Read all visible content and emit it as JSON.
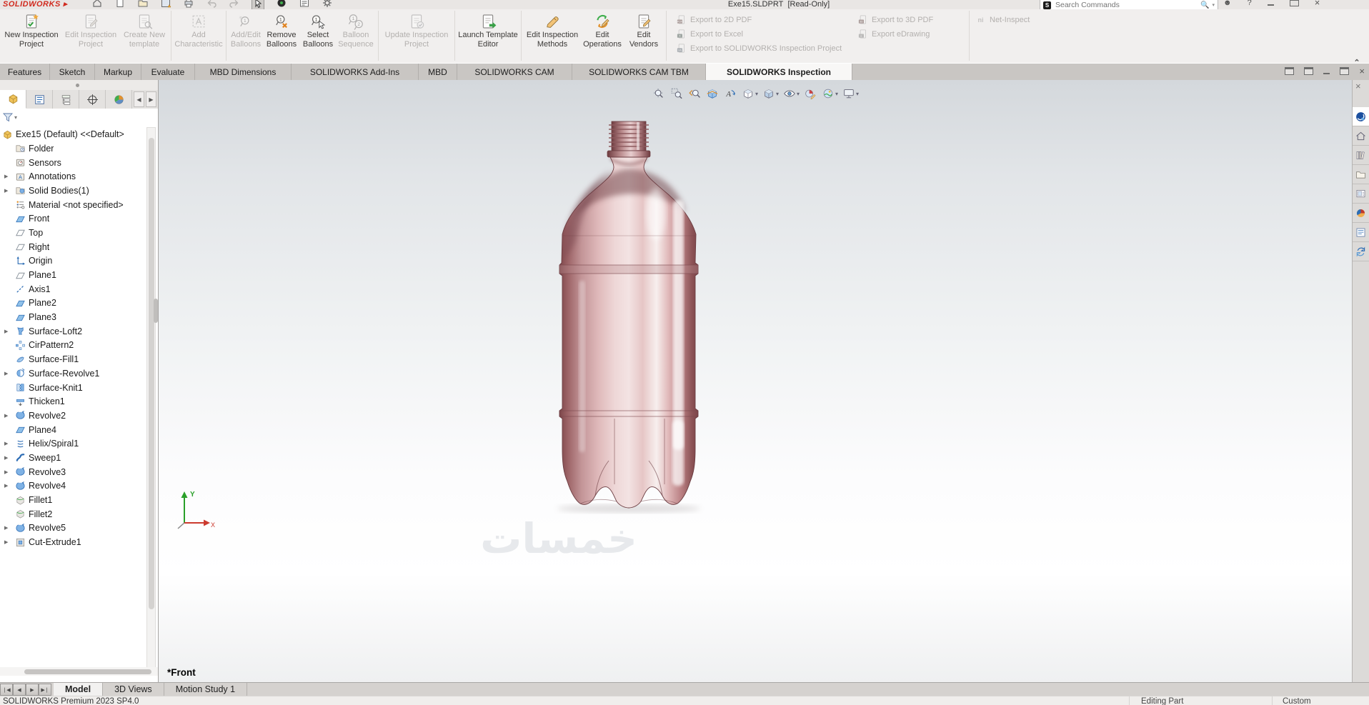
{
  "window": {
    "app": "SOLIDWORKS",
    "title": "Exe15.SLDPRT",
    "mode": "[Read-Only]",
    "search_placeholder": "Search Commands"
  },
  "quick_access": [
    {
      "icon": "home-icon"
    },
    {
      "icon": "new-doc-icon"
    },
    {
      "icon": "open-icon"
    },
    {
      "icon": "save-icon"
    },
    {
      "icon": "print-icon"
    },
    {
      "icon": "undo-icon",
      "enabled": false
    },
    {
      "icon": "redo-icon",
      "enabled": false
    },
    {
      "icon": "select-cursor-icon",
      "active": true
    },
    {
      "icon": "rebuild-icon"
    },
    {
      "icon": "display-settings-icon"
    },
    {
      "icon": "options-gear-icon"
    }
  ],
  "ribbon": {
    "buttons": [
      {
        "label": "New Inspection Project",
        "icon": "new-inspection-project",
        "enabled": true
      },
      {
        "label": "Edit Inspection Project",
        "icon": "edit-inspection-project",
        "enabled": false
      },
      {
        "label": "Create New template",
        "icon": "create-new-template",
        "enabled": false,
        "sep": true
      },
      {
        "label": "Add Characteristic",
        "icon": "add-characteristic",
        "enabled": false,
        "sep": true
      },
      {
        "label": "Add/Edit Balloons",
        "icon": "add-edit-balloons",
        "enabled": false
      },
      {
        "label": "Remove Balloons",
        "icon": "remove-balloons",
        "enabled": true
      },
      {
        "label": "Select Balloons",
        "icon": "select-balloons",
        "enabled": true
      },
      {
        "label": "Balloon Sequence",
        "icon": "balloon-sequence",
        "enabled": false,
        "sep": true
      },
      {
        "label": "Update Inspection Project",
        "icon": "update-inspection-project",
        "enabled": false,
        "sep": true
      },
      {
        "label": "Launch Template Editor",
        "icon": "launch-template-editor",
        "enabled": true,
        "sep": true
      },
      {
        "label": "Edit Inspection Methods",
        "icon": "edit-inspection-methods",
        "enabled": true
      },
      {
        "label": "Edit Operations",
        "icon": "edit-operations",
        "enabled": true
      },
      {
        "label": "Edit Vendors",
        "icon": "edit-vendors",
        "enabled": true,
        "sep": true
      }
    ],
    "export_left": [
      {
        "label": "Export to 2D PDF",
        "icon": "export-2d-pdf",
        "enabled": false
      },
      {
        "label": "Export to Excel",
        "icon": "export-excel",
        "enabled": false
      },
      {
        "label": "Export to SOLIDWORKS Inspection Project",
        "icon": "export-sw-inspection",
        "enabled": false
      }
    ],
    "export_right": [
      {
        "label": "Export to 3D PDF",
        "icon": "export-3d-pdf",
        "enabled": false
      },
      {
        "label": "Export eDrawing",
        "icon": "export-edrawing",
        "enabled": false
      }
    ],
    "net_inspect": {
      "label": "Net-Inspect",
      "icon": "net-inspect",
      "enabled": false
    }
  },
  "tabs": [
    {
      "label": "Features"
    },
    {
      "label": "Sketch"
    },
    {
      "label": "Markup"
    },
    {
      "label": "Evaluate"
    },
    {
      "label": "MBD Dimensions"
    },
    {
      "label": "SOLIDWORKS Add-Ins"
    },
    {
      "label": "MBD"
    },
    {
      "label": "SOLIDWORKS CAM"
    },
    {
      "label": "SOLIDWORKS CAM TBM"
    },
    {
      "label": "SOLIDWORKS Inspection",
      "active": true
    }
  ],
  "panel": {
    "tabs": [
      {
        "icon": "featuremanager-icon",
        "active": true
      },
      {
        "icon": "propertymanager-icon"
      },
      {
        "icon": "configurationmanager-icon"
      },
      {
        "icon": "dimxpertmanager-icon"
      },
      {
        "icon": "displaymanager-icon"
      }
    ],
    "tree": {
      "root": {
        "label": "Exe15 (Default) <<Default>",
        "icon": "part"
      },
      "items": [
        {
          "label": "Folder",
          "icon": "folder-history"
        },
        {
          "label": "Sensors",
          "icon": "sensors"
        },
        {
          "label": "Annotations",
          "icon": "annotations",
          "expandable": true
        },
        {
          "label": "Solid Bodies(1)",
          "icon": "solid-bodies",
          "expandable": true
        },
        {
          "label": "Material <not specified>",
          "icon": "material"
        },
        {
          "label": "Front",
          "icon": "plane-shaded"
        },
        {
          "label": "Top",
          "icon": "plane"
        },
        {
          "label": "Right",
          "icon": "plane"
        },
        {
          "label": "Origin",
          "icon": "origin"
        },
        {
          "label": "Plane1",
          "icon": "plane"
        },
        {
          "label": "Axis1",
          "icon": "axis"
        },
        {
          "label": "Plane2",
          "icon": "plane-shaded"
        },
        {
          "label": "Plane3",
          "icon": "plane-shaded"
        },
        {
          "label": "Surface-Loft2",
          "icon": "surface-loft",
          "expandable": true
        },
        {
          "label": "CirPattern2",
          "icon": "cirpattern"
        },
        {
          "label": "Surface-Fill1",
          "icon": "surface-fill"
        },
        {
          "label": "Surface-Revolve1",
          "icon": "surface-revolve",
          "expandable": true
        },
        {
          "label": "Surface-Knit1",
          "icon": "surface-knit"
        },
        {
          "label": "Thicken1",
          "icon": "thicken"
        },
        {
          "label": "Revolve2",
          "icon": "revolve",
          "expandable": true
        },
        {
          "label": "Plane4",
          "icon": "plane-shaded"
        },
        {
          "label": "Helix/Spiral1",
          "icon": "helix",
          "expandable": true
        },
        {
          "label": "Sweep1",
          "icon": "sweep",
          "expandable": true
        },
        {
          "label": "Revolve3",
          "icon": "revolve",
          "expandable": true
        },
        {
          "label": "Revolve4",
          "icon": "revolve",
          "expandable": true
        },
        {
          "label": "Fillet1",
          "icon": "fillet"
        },
        {
          "label": "Fillet2",
          "icon": "fillet"
        },
        {
          "label": "Revolve5",
          "icon": "revolve",
          "expandable": true
        },
        {
          "label": "Cut-Extrude1",
          "icon": "cut-extrude",
          "expandable": true
        }
      ]
    }
  },
  "headsup": [
    {
      "icon": "zoom-fit-icon"
    },
    {
      "icon": "zoom-area-icon"
    },
    {
      "icon": "previous-view-icon"
    },
    {
      "icon": "section-view-icon",
      "active": true
    },
    {
      "icon": "annotation-views-icon"
    },
    {
      "icon": "view-orientation-icon",
      "dropdown": true
    },
    {
      "icon": "display-style-icon",
      "dropdown": true
    },
    {
      "icon": "hide-show-icon",
      "dropdown": true
    },
    {
      "icon": "edit-appearance-icon"
    },
    {
      "icon": "apply-scene-icon",
      "dropdown": true
    },
    {
      "icon": "view-settings-icon",
      "dropdown": true
    }
  ],
  "taskpane": [
    {
      "icon": "threedexperience-icon",
      "active": true
    },
    {
      "icon": "home-resources-icon"
    },
    {
      "icon": "design-library-icon"
    },
    {
      "icon": "file-explorer-icon"
    },
    {
      "icon": "view-palette-icon"
    },
    {
      "icon": "appearances-icon"
    },
    {
      "icon": "custom-properties-icon"
    },
    {
      "icon": "forum-icon"
    }
  ],
  "viewport": {
    "view_label": "*Front",
    "watermark": "خمسات",
    "triad": {
      "x": "X",
      "y": "Y"
    }
  },
  "bottom_tabs": [
    {
      "label": "Model",
      "active": true
    },
    {
      "label": "3D Views"
    },
    {
      "label": "Motion Study 1"
    }
  ],
  "statusbar": {
    "left": "SOLIDWORKS Premium 2023 SP4.0",
    "editing": "Editing Part",
    "units": "Custom"
  },
  "colors": {
    "accent_red": "#d12a1e",
    "bottle_pink": "#e6c6c7",
    "bottle_dark": "#7d464a",
    "feature_blue": "#2d6db5",
    "part_yellow": "#f0c35a"
  }
}
